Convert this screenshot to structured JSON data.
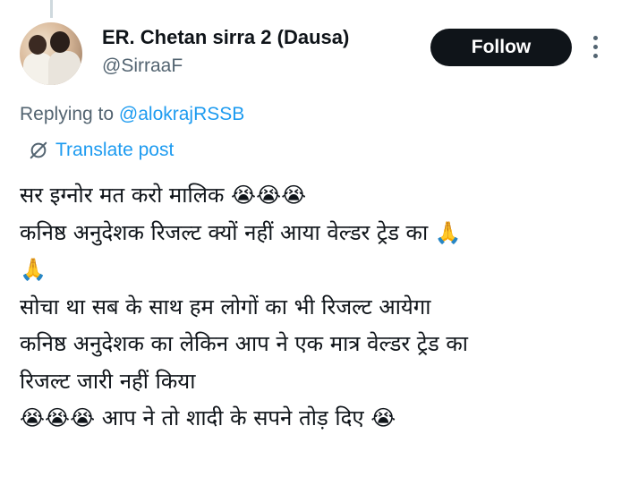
{
  "author": {
    "name": "ER. Chetan sirra 2 (Dausa)",
    "handle": "@SirraaF"
  },
  "actions": {
    "follow_label": "Follow",
    "more_icon": "more-vertical-icon"
  },
  "reply": {
    "prefix": "Replying to ",
    "mention": "@alokrajRSSB"
  },
  "translate": {
    "label": "Translate post",
    "icon": "globe-slash-icon"
  },
  "post": {
    "text": "सर इग्नोर मत करो मालिक 😭😭😭\nकनिष्ठ अनुदेशक रिजल्ट क्यों नहीं आया वेल्डर ट्रेड का 🙏\n🙏\nसोचा था सब के साथ हम लोगों का भी रिजल्ट आयेगा\nकनिष्ठ अनुदेशक का लेकिन आप ने एक मात्र वेल्डर ट्रेड का\nरिजल्ट जारी नहीं किया\n😭😭😭 आप ने तो शादी के सपने तोड़ दिए 😭"
  },
  "colors": {
    "accent": "#1d9bf0",
    "text": "#0f1419",
    "secondary": "#536471",
    "button": "#0f1419"
  }
}
